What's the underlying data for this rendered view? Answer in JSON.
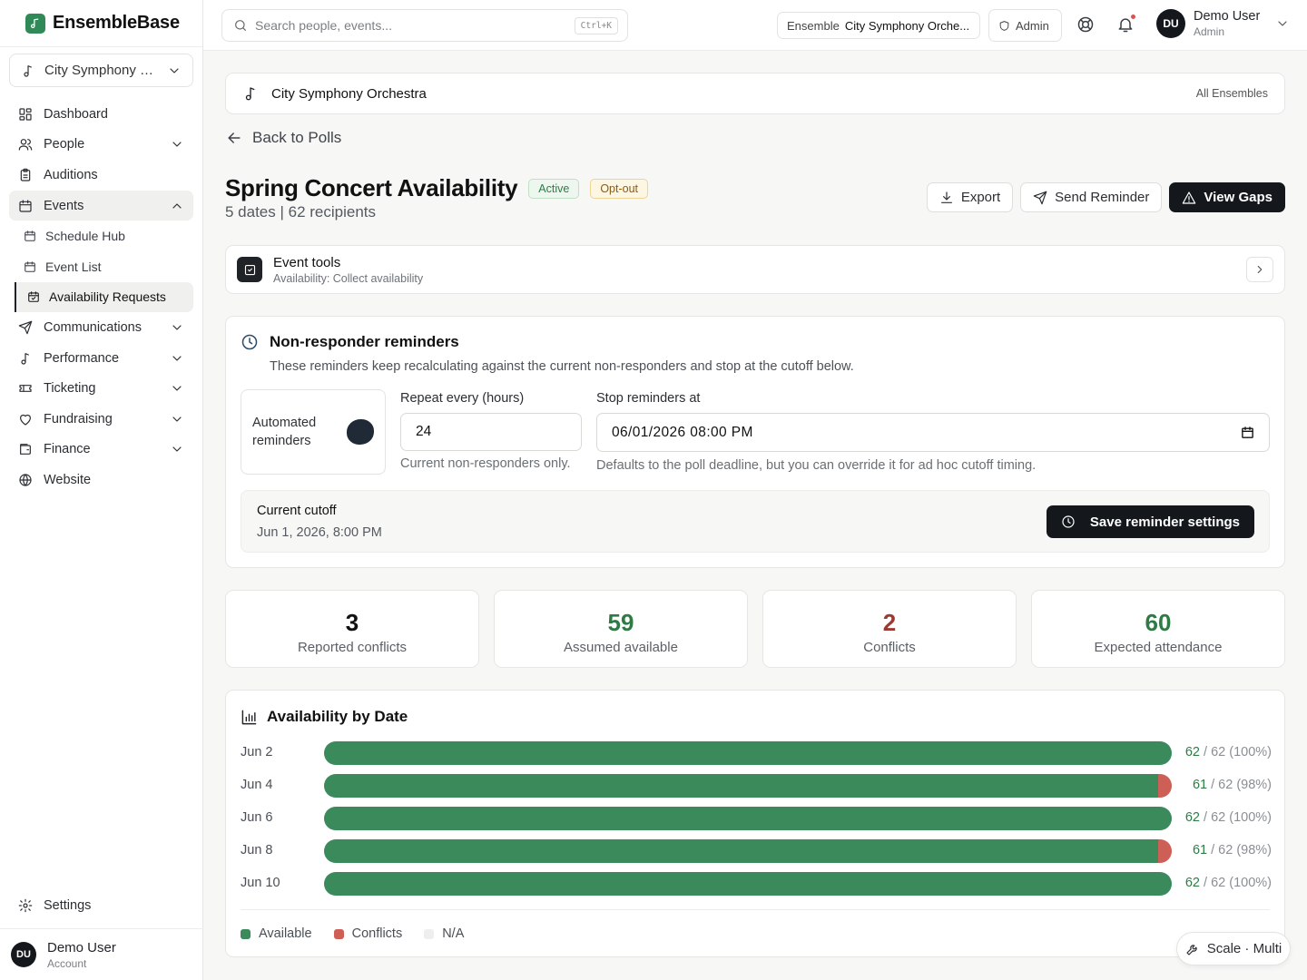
{
  "brand": {
    "name": "EnsembleBase"
  },
  "sidebar": {
    "ensemble_select": "City Symphony O...",
    "items": [
      {
        "label": "Dashboard"
      },
      {
        "label": "People"
      },
      {
        "label": "Auditions"
      },
      {
        "label": "Events"
      },
      {
        "label": "Schedule Hub"
      },
      {
        "label": "Event List"
      },
      {
        "label": "Availability Requests"
      },
      {
        "label": "Communications"
      },
      {
        "label": "Performance"
      },
      {
        "label": "Ticketing"
      },
      {
        "label": "Fundraising"
      },
      {
        "label": "Finance"
      },
      {
        "label": "Website"
      }
    ],
    "settings": "Settings",
    "user": {
      "initials": "DU",
      "name": "Demo User",
      "role": "Account"
    }
  },
  "topbar": {
    "search_placeholder": "Search people, events...",
    "shortcut": "Ctrl+K",
    "ensemble_label": "Ensemble",
    "ensemble_value": "City Symphony Orche...",
    "admin": "Admin",
    "user": {
      "initials": "DU",
      "name": "Demo User",
      "role": "Admin"
    }
  },
  "breadcrumb": {
    "name": "City Symphony Orchestra",
    "link": "All Ensembles"
  },
  "back": "Back to Polls",
  "poll": {
    "title": "Spring Concert Availability",
    "badge_status": "Active",
    "badge_mode": "Opt-out",
    "subtitle": "5 dates | 62 recipients",
    "export": "Export",
    "send_reminder": "Send Reminder",
    "view_gaps": "View Gaps"
  },
  "tools": {
    "title": "Event tools",
    "subtitle": "Availability: Collect availability"
  },
  "reminders": {
    "title": "Non-responder reminders",
    "description": "These reminders keep recalculating against the current non-responders and stop at the cutoff below.",
    "automated_label": "Automated reminders",
    "repeat_label": "Repeat every (hours)",
    "repeat_value": "24",
    "repeat_hint": "Current non-responders only.",
    "stop_label": "Stop reminders at",
    "stop_value": "06/01/2026 08:00 PM",
    "stop_hint": "Defaults to the poll deadline, but you can override it for ad hoc cutoff timing.",
    "cutoff_label": "Current cutoff",
    "cutoff_value": "Jun 1, 2026, 8:00 PM",
    "save": "Save reminder settings"
  },
  "stats": [
    {
      "value": "3",
      "label": "Reported conflicts",
      "color": "#111111"
    },
    {
      "value": "59",
      "label": "Assumed available",
      "color": "#2e7b46"
    },
    {
      "value": "2",
      "label": "Conflicts",
      "color": "#9b3a33"
    },
    {
      "value": "60",
      "label": "Expected attendance",
      "color": "#2e7b46"
    }
  ],
  "chart_data": {
    "type": "bar",
    "title": "Availability by Date",
    "categories": [
      "Jun 2",
      "Jun 4",
      "Jun 6",
      "Jun 8",
      "Jun 10"
    ],
    "total": 62,
    "series": [
      {
        "name": "Available",
        "values": [
          62,
          61,
          62,
          61,
          62
        ]
      },
      {
        "name": "Conflicts",
        "values": [
          0,
          1,
          0,
          1,
          0
        ]
      },
      {
        "name": "N/A",
        "values": [
          0,
          0,
          0,
          0,
          0
        ]
      }
    ],
    "labels": [
      "62 / 62 (100%)",
      "61 / 62 (98%)",
      "62 / 62 (100%)",
      "61 / 62 (98%)",
      "62 / 62 (100%)"
    ],
    "colors": {
      "Available": "#3a8a5b",
      "Conflicts": "#cd5f57",
      "N/A": "#eeeeec"
    },
    "legend_position": "bottom-left"
  },
  "scale": "Scale · Multi"
}
